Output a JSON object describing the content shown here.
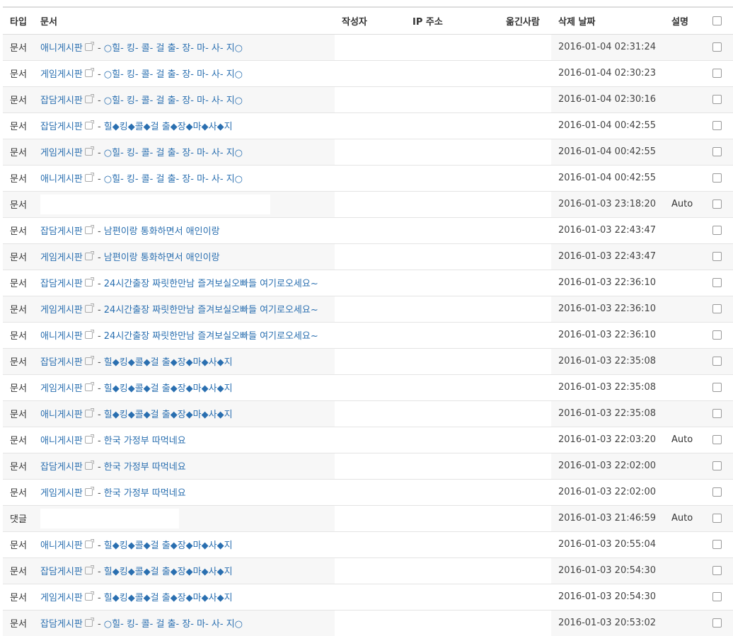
{
  "headers": {
    "type": "타입",
    "document": "문서",
    "author": "작성자",
    "ip": "IP 주소",
    "mover": "옮긴사람",
    "deleted_date": "삭제 날짜",
    "description": "설명"
  },
  "rows": [
    {
      "type": "문서",
      "board": "애니게시판",
      "sep": " - ",
      "title": "○힐- 킹- 콜- 걸 출- 장- 마- 사- 지○",
      "date": "2016-01-04 02:31:24",
      "desc": ""
    },
    {
      "type": "문서",
      "board": "게임게시판",
      "sep": " - ",
      "title": "○힐- 킹- 콜- 걸 출- 장- 마- 사- 지○",
      "date": "2016-01-04 02:30:23",
      "desc": ""
    },
    {
      "type": "문서",
      "board": "잡담게시판",
      "sep": " - ",
      "title": "○힐- 킹- 콜- 걸 출- 장- 마- 사- 지○",
      "date": "2016-01-04 02:30:16",
      "desc": ""
    },
    {
      "type": "문서",
      "board": "잡담게시판",
      "sep": " - ",
      "title": "힐◆킹◆콜◆걸 출◆장◆마◆사◆지",
      "date": "2016-01-04 00:42:55",
      "desc": ""
    },
    {
      "type": "문서",
      "board": "게임게시판",
      "sep": " - ",
      "title": "○힐- 킹- 콜- 걸 출- 장- 마- 사- 지○",
      "date": "2016-01-04 00:42:55",
      "desc": ""
    },
    {
      "type": "문서",
      "board": "애니게시판",
      "sep": " - ",
      "title": "○힐- 킹- 콜- 걸 출- 장- 마- 사- 지○",
      "date": "2016-01-04 00:42:55",
      "desc": ""
    },
    {
      "type": "문서",
      "board": "",
      "sep": "",
      "title": "",
      "date": "2016-01-03 23:18:20",
      "desc": "Auto",
      "redacted": true
    },
    {
      "type": "문서",
      "board": "잡담게시판",
      "sep": " - ",
      "title": "남편이랑 통화하면서 애인이랑",
      "date": "2016-01-03 22:43:47",
      "desc": ""
    },
    {
      "type": "문서",
      "board": "게임게시판",
      "sep": " - ",
      "title": "남편이랑 통화하면서 애인이랑",
      "date": "2016-01-03 22:43:47",
      "desc": ""
    },
    {
      "type": "문서",
      "board": "잡담게시판",
      "sep": " - ",
      "title": "24시간출장 짜릿한만남 즐겨보실오빠들 여기로오세요~",
      "date": "2016-01-03 22:36:10",
      "desc": ""
    },
    {
      "type": "문서",
      "board": "게임게시판",
      "sep": " - ",
      "title": "24시간출장 짜릿한만남 즐겨보실오빠들 여기로오세요~",
      "date": "2016-01-03 22:36:10",
      "desc": ""
    },
    {
      "type": "문서",
      "board": "애니게시판",
      "sep": " - ",
      "title": "24시간출장 짜릿한만남 즐겨보실오빠들 여기로오세요~",
      "date": "2016-01-03 22:36:10",
      "desc": ""
    },
    {
      "type": "문서",
      "board": "잡담게시판",
      "sep": " - ",
      "title": "힐◆킹◆콜◆걸 출◆장◆마◆사◆지",
      "date": "2016-01-03 22:35:08",
      "desc": ""
    },
    {
      "type": "문서",
      "board": "게임게시판",
      "sep": " - ",
      "title": "힐◆킹◆콜◆걸 출◆장◆마◆사◆지",
      "date": "2016-01-03 22:35:08",
      "desc": ""
    },
    {
      "type": "문서",
      "board": "애니게시판",
      "sep": " - ",
      "title": "힐◆킹◆콜◆걸 출◆장◆마◆사◆지",
      "date": "2016-01-03 22:35:08",
      "desc": ""
    },
    {
      "type": "문서",
      "board": "애니게시판",
      "sep": " - ",
      "title": "한국 가정부 따먹네요",
      "date": "2016-01-03 22:03:20",
      "desc": "Auto"
    },
    {
      "type": "문서",
      "board": "잡담게시판",
      "sep": " - ",
      "title": "한국 가정부 따먹네요",
      "date": "2016-01-03 22:02:00",
      "desc": ""
    },
    {
      "type": "문서",
      "board": "게임게시판",
      "sep": " - ",
      "title": "한국 가정부 따먹네요",
      "date": "2016-01-03 22:02:00",
      "desc": ""
    },
    {
      "type": "댓글",
      "board": "",
      "sep": "",
      "title": "",
      "date": "2016-01-03 21:46:59",
      "desc": "Auto",
      "redacted": true
    },
    {
      "type": "문서",
      "board": "애니게시판",
      "sep": " - ",
      "title": "힐◆킹◆콜◆걸 출◆장◆마◆사◆지",
      "date": "2016-01-03 20:55:04",
      "desc": ""
    },
    {
      "type": "문서",
      "board": "잡담게시판",
      "sep": " - ",
      "title": "힐◆킹◆콜◆걸 출◆장◆마◆사◆지",
      "date": "2016-01-03 20:54:30",
      "desc": ""
    },
    {
      "type": "문서",
      "board": "게임게시판",
      "sep": " - ",
      "title": "힐◆킹◆콜◆걸 출◆장◆마◆사◆지",
      "date": "2016-01-03 20:54:30",
      "desc": ""
    },
    {
      "type": "문서",
      "board": "잡담게시판",
      "sep": " - ",
      "title": "○힐- 킹- 콜- 걸 출- 장- 마- 사- 지○",
      "date": "2016-01-03 20:53:02",
      "desc": ""
    }
  ],
  "icons": {
    "external_link": "external-link-icon",
    "checkbox": "checkbox-icon"
  }
}
